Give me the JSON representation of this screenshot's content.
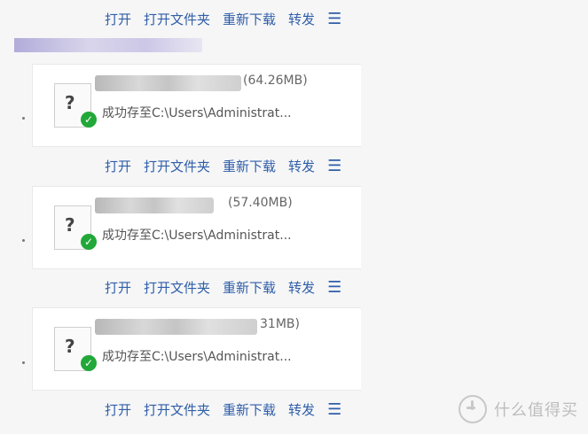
{
  "actions": [
    "打开",
    "打开文件夹",
    "重新下载",
    "转发"
  ],
  "files": [
    {
      "size": "(64.26MB)",
      "status": "成功存至C:\\Users\\Administrat..."
    },
    {
      "size": "(57.40MB)",
      "status": "成功存至C:\\Users\\Administrat..."
    },
    {
      "size": "31MB)",
      "status": "成功存至C:\\Users\\Administrat..."
    }
  ],
  "watermark": {
    "text": "什么值得买"
  },
  "icons": {
    "file": "question-file-icon",
    "success": "check-icon",
    "menu": "hamburger-icon"
  }
}
